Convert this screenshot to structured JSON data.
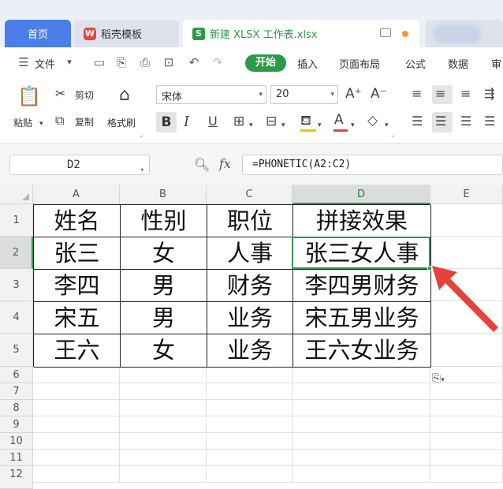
{
  "tabs": {
    "home": "首页",
    "templates": "稻壳模板",
    "file": "新建 XLSX 工作表.xlsx",
    "templates_badge": "W",
    "file_badge": "S"
  },
  "menu": {
    "file": "文件",
    "start": "开始",
    "insert": "插入",
    "layout": "页面布局",
    "formula": "公式",
    "data": "数据",
    "review": "审"
  },
  "ribbon": {
    "paste": "粘贴",
    "cut": "剪切",
    "copy": "复制",
    "format_painter": "格式刷",
    "font_name": "宋体",
    "font_size": "20",
    "bold": "B",
    "italic": "I",
    "underline": "U"
  },
  "formula_bar": {
    "cell_ref": "D2",
    "fx": "fx",
    "formula": "=PHONETIC(A2:C2)"
  },
  "sheet": {
    "columns": [
      "A",
      "B",
      "C",
      "D",
      "E"
    ],
    "rows": [
      "1",
      "2",
      "3",
      "4",
      "5",
      "6",
      "7",
      "8",
      "9",
      "10",
      "11",
      "12"
    ],
    "active_cell": "D2",
    "table": [
      [
        "姓名",
        "性别",
        "职位",
        "拼接效果"
      ],
      [
        "张三",
        "女",
        "人事",
        "张三女人事"
      ],
      [
        "李四",
        "男",
        "财务",
        "李四男财务"
      ],
      [
        "宋五",
        "男",
        "业务",
        "宋五男业务"
      ],
      [
        "王六",
        "女",
        "业务",
        "王六女业务"
      ]
    ]
  },
  "colors": {
    "accent_green": "#2d9a49",
    "home_tab_blue": "#4a7ee8",
    "arrow_red": "#e8403a"
  }
}
